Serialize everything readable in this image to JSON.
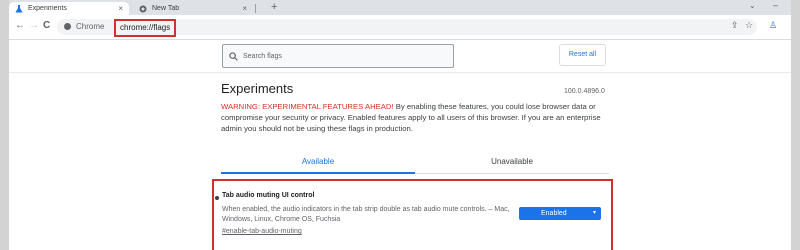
{
  "browser": {
    "tabs": [
      {
        "title": "Experiments",
        "active": true,
        "icon": "flask-icon"
      },
      {
        "title": "New Tab",
        "active": false,
        "icon": "chrome-icon"
      }
    ],
    "new_tab_symbol": "+",
    "tab_close_symbol": "×",
    "chevron_symbol": "⌄",
    "minimize_symbol": "–",
    "nav": {
      "back": "←",
      "forward": "→",
      "reload": "C"
    },
    "omnibox": {
      "chip_label": "Chrome",
      "url": "chrome://flags"
    },
    "toolbar_icons": {
      "share": "⇪",
      "bookmark": "☆",
      "profile": "♙"
    }
  },
  "flags_page": {
    "search_placeholder": "Search flags",
    "reset_button": "Reset all",
    "title": "Experiments",
    "version": "100.0.4896.0",
    "warning_lead": "WARNING: EXPERIMENTAL FEATURES AHEAD!",
    "warning_body": " By enabling these features, you could lose browser data or compromise your security or privacy. Enabled features apply to all users of this browser. If you are an enterprise admin you should not be using these flags in production.",
    "tabs": {
      "available": "Available",
      "unavailable": "Unavailable"
    },
    "experiment": {
      "title": "Tab audio muting UI control",
      "description": "When enabled, the audio indicators in the tab strip double as tab audio mute controls. – Mac, Windows, Linux, Chrome OS, Fuchsia",
      "link": "#enable-tab-audio-muting",
      "selected": "Enabled",
      "caret": "▾"
    }
  },
  "colors": {
    "accent": "#1a73e8",
    "highlight": "#d32f2f",
    "warning": "#d93025"
  }
}
